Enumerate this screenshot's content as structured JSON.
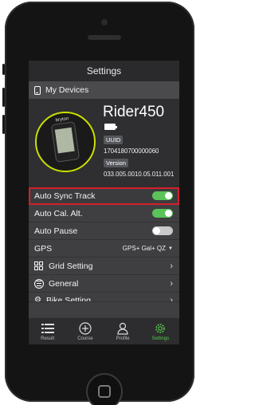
{
  "header": {
    "title": "Settings"
  },
  "my_devices": {
    "label": "My Devices"
  },
  "device": {
    "brand": "bryton",
    "name": "Rider450",
    "uuid_label": "UUID",
    "uuid_value": "1704180700000060",
    "version_label": "Version",
    "version_value": "033.005.0010.05.011.001"
  },
  "settings": {
    "auto_sync": {
      "label": "Auto Sync Track",
      "state": "on"
    },
    "auto_cal": {
      "label": "Auto Cal. Alt.",
      "state": "on"
    },
    "auto_pause": {
      "label": "Auto Pause",
      "state": "off"
    },
    "gps": {
      "label": "GPS",
      "value": "GPS+ Gal+ QZ"
    },
    "grid": {
      "label": "Grid Setting"
    },
    "general": {
      "label": "General"
    },
    "bike": {
      "label": "Bike Setting"
    }
  },
  "tabs": [
    {
      "label": "Result",
      "icon": "list-icon"
    },
    {
      "label": "Course",
      "icon": "plus-circle-icon"
    },
    {
      "label": "Profile",
      "icon": "person-icon"
    },
    {
      "label": "Settings",
      "icon": "gear-icon"
    }
  ],
  "colors": {
    "accent_green": "#57c84d",
    "toggle_on": "#5bc35a",
    "highlight_red": "#d3202a"
  }
}
